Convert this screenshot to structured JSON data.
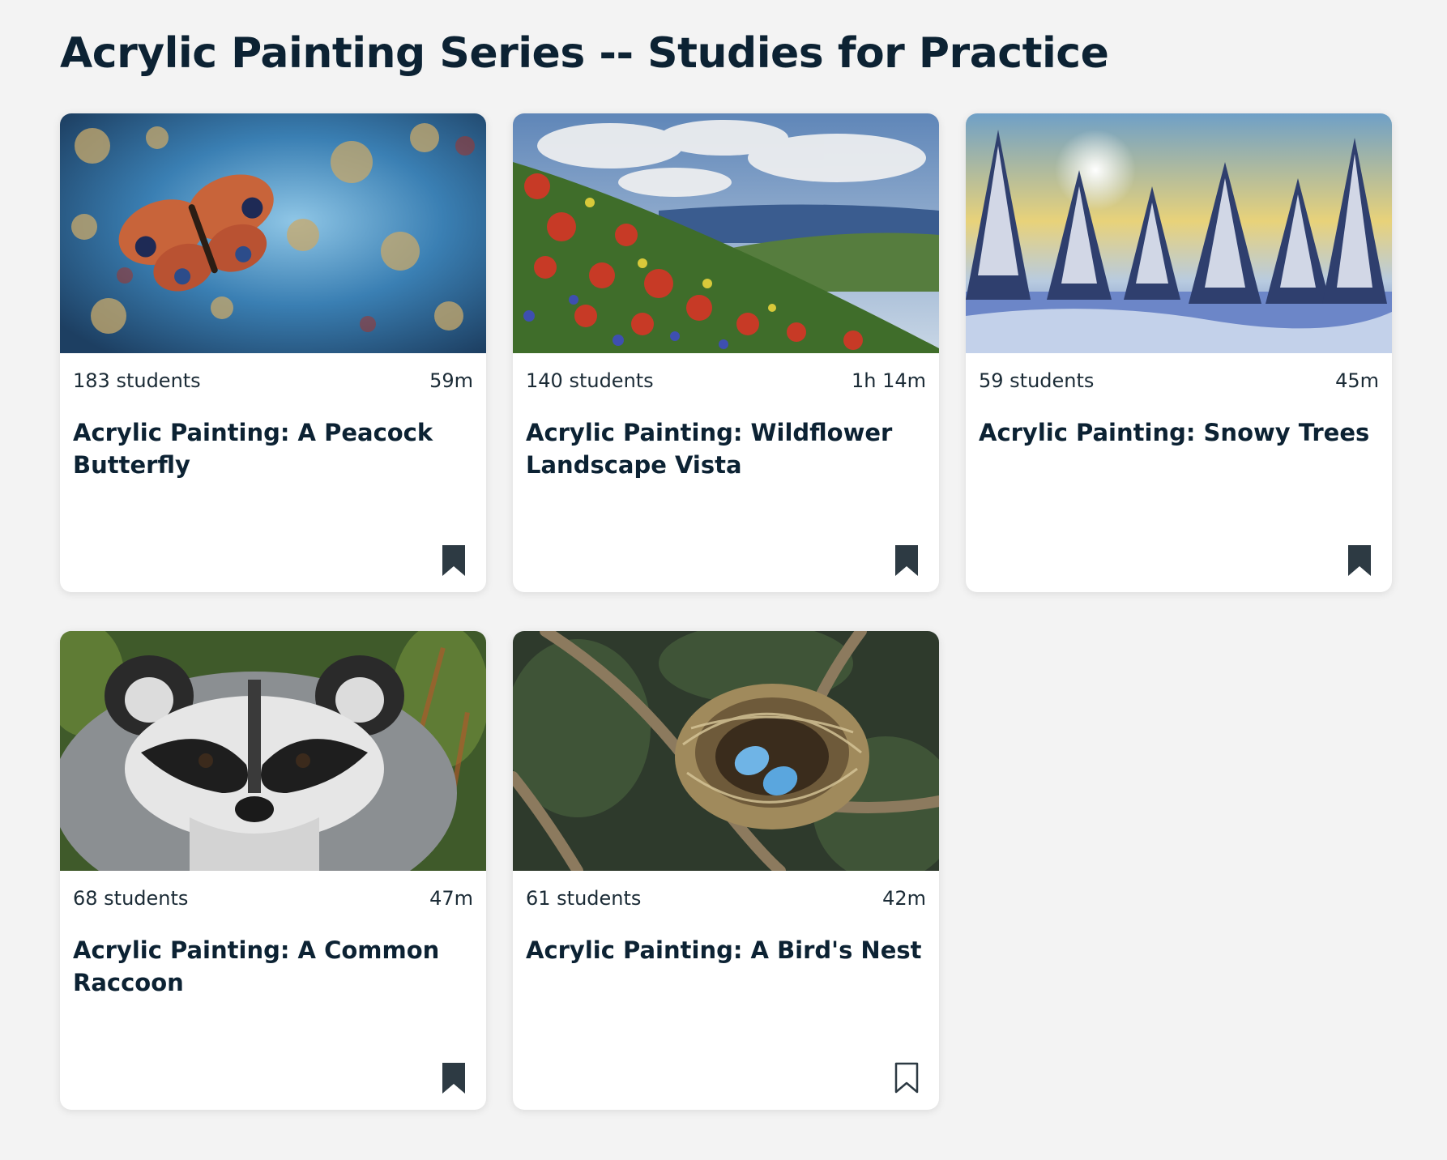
{
  "page": {
    "title": "Acrylic Painting Series -- Studies for Practice"
  },
  "colors": {
    "background": "#f3f3f3",
    "text": "#0c2233",
    "card": "#ffffff",
    "bookmark": "#2d3a43"
  },
  "cards": [
    {
      "students": "183 students",
      "duration": "59m",
      "title": "Acrylic Painting: A Peacock Butterfly",
      "image": "peacock-butterfly-painting",
      "saved": true
    },
    {
      "students": "140 students",
      "duration": "1h 14m",
      "title": "Acrylic Painting: Wildflower Landscape Vista",
      "image": "wildflower-landscape-painting",
      "saved": true
    },
    {
      "students": "59 students",
      "duration": "45m",
      "title": "Acrylic Painting: Snowy Trees",
      "image": "snowy-trees-painting",
      "saved": true
    },
    {
      "students": "68 students",
      "duration": "47m",
      "title": "Acrylic Painting: A Common Raccoon",
      "image": "raccoon-painting",
      "saved": true
    },
    {
      "students": "61 students",
      "duration": "42m",
      "title": "Acrylic Painting: A Bird's Nest",
      "image": "birds-nest-painting",
      "saved": false
    }
  ]
}
